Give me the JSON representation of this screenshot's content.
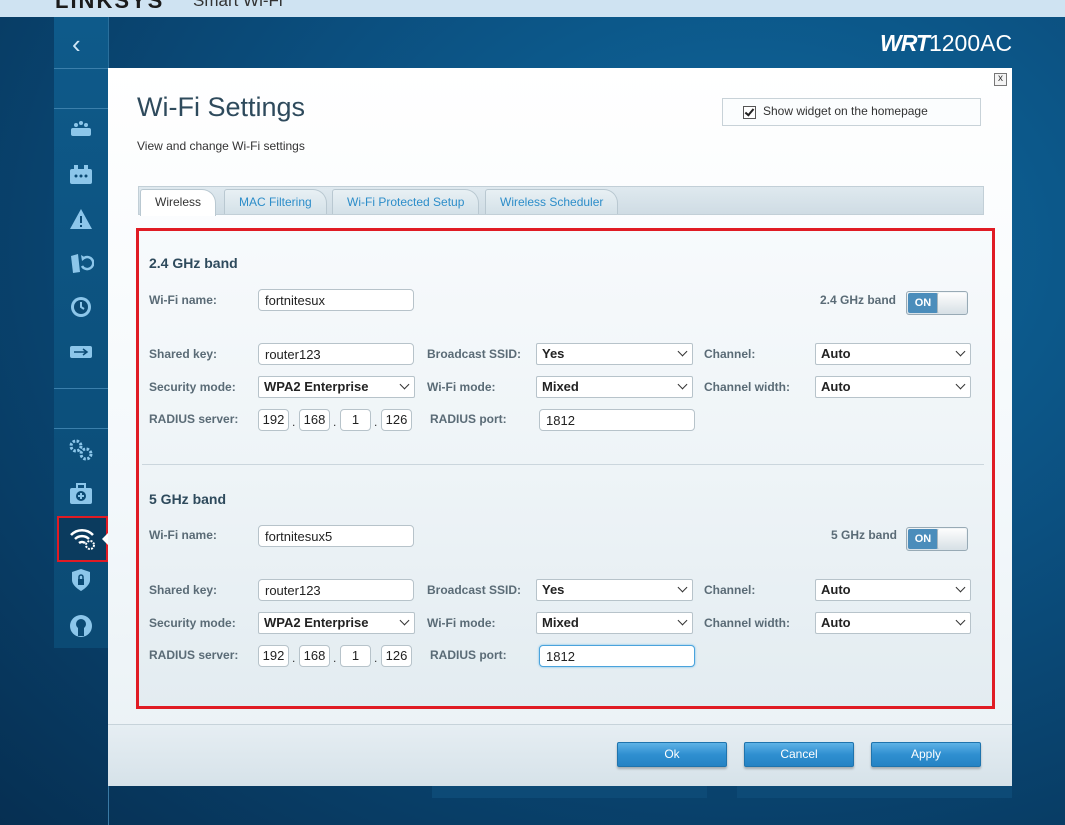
{
  "brand": {
    "logo": "LINKSYS",
    "product": "Smart Wi-Fi",
    "model_bold": "WRT",
    "model_rest": "1200AC"
  },
  "sidebar": {
    "items": [
      {
        "name": "device-list"
      },
      {
        "name": "network-map"
      },
      {
        "name": "troubleshooting"
      },
      {
        "name": "external-storage"
      },
      {
        "name": "speed-test"
      },
      {
        "name": "usb"
      },
      {
        "name": "connectivity"
      },
      {
        "name": "troubleshooting-kit"
      },
      {
        "name": "wifi-settings",
        "active": true
      },
      {
        "name": "security"
      },
      {
        "name": "parental-controls"
      }
    ]
  },
  "dialog": {
    "title": "Wi-Fi Settings",
    "subtitle": "View and change Wi-Fi settings",
    "widget_label": "Show widget on the homepage",
    "widget_checked": true,
    "close": "x",
    "tabs": [
      {
        "label": "Wireless",
        "active": true
      },
      {
        "label": "MAC Filtering"
      },
      {
        "label": "Wi-Fi Protected Setup"
      },
      {
        "label": "Wireless Scheduler"
      }
    ]
  },
  "labels": {
    "wifi_name": "Wi-Fi name:",
    "shared_key": "Shared key:",
    "security_mode": "Security mode:",
    "radius_server": "RADIUS server:",
    "broadcast_ssid": "Broadcast SSID:",
    "wifi_mode": "Wi-Fi mode:",
    "radius_port": "RADIUS port:",
    "channel": "Channel:",
    "channel_width": "Channel width:",
    "ip_dot": "."
  },
  "band24": {
    "title": "2.4 GHz band",
    "toggle_label": "2.4 GHz band",
    "toggle_state": "ON",
    "wifi_name": "fortnitesux",
    "shared_key": "router123",
    "security_mode": "WPA2 Enterprise",
    "broadcast_ssid": "Yes",
    "wifi_mode": "Mixed",
    "channel": "Auto",
    "channel_width": "Auto",
    "radius_ip": [
      "192",
      "168",
      "1",
      "126"
    ],
    "radius_port": "1812"
  },
  "band5": {
    "title": "5 GHz band",
    "toggle_label": "5 GHz band",
    "toggle_state": "ON",
    "wifi_name": "fortnitesux5",
    "shared_key": "router123",
    "security_mode": "WPA2 Enterprise",
    "broadcast_ssid": "Yes",
    "wifi_mode": "Mixed",
    "channel": "Auto",
    "channel_width": "Auto",
    "radius_ip": [
      "192",
      "168",
      "1",
      "126"
    ],
    "radius_port": "1812"
  },
  "footer": {
    "ok": "Ok",
    "cancel": "Cancel",
    "apply": "Apply"
  },
  "colors": {
    "accent": "#2f8fd0",
    "highlight": "#e01b24",
    "toggle_on": "#4b8dbb"
  }
}
